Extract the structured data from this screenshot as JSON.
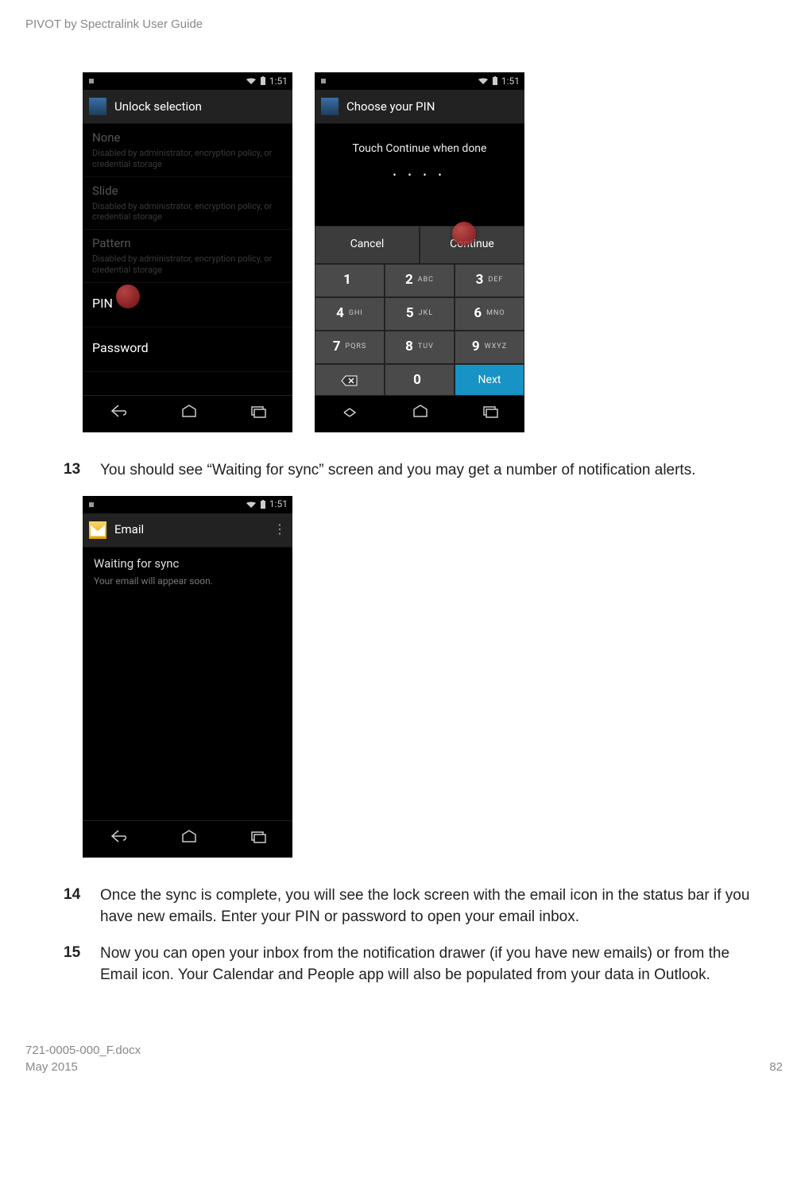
{
  "doc": {
    "running_header": "PIVOT by Spectralink User Guide",
    "footer_left_line1": "721-0005-000_F.docx",
    "footer_left_line2": "May 2015",
    "footer_right": "82"
  },
  "steps": {
    "s13_num": "13",
    "s13_text": "You should see “Waiting for sync” screen and you may get a number of notification alerts.",
    "s14_num": "14",
    "s14_text": "Once the sync is complete, you will see the lock screen with the email icon in the status bar if you have new emails. Enter your PIN or password to open your email inbox.",
    "s15_num": "15",
    "s15_text": "Now you can open your inbox from the notification drawer (if you have new emails) or from the Email icon. Your Calendar and People app will also be populated from your data in Outlook."
  },
  "screen_unlock": {
    "time": "1:51",
    "title": "Unlock selection",
    "opt_none_title": "None",
    "opt_disabled_sub": "Disabled by administrator, encryption policy, or credential storage",
    "opt_slide_title": "Slide",
    "opt_pattern_title": "Pattern",
    "opt_pin_title": "PIN",
    "opt_password_title": "Password"
  },
  "screen_pin": {
    "time": "1:51",
    "title": "Choose your PIN",
    "instruction": "Touch Continue when done",
    "dots": "• • • •",
    "cancel": "Cancel",
    "continue": "Continue",
    "next": "Next",
    "keys": {
      "k1": "1",
      "k2n": "2",
      "k2l": "ABC",
      "k3n": "3",
      "k3l": "DEF",
      "k4n": "4",
      "k4l": "GHI",
      "k5n": "5",
      "k5l": "JKL",
      "k6n": "6",
      "k6l": "MNO",
      "k7n": "7",
      "k7l": "PQRS",
      "k8n": "8",
      "k8l": "TUV",
      "k9n": "9",
      "k9l": "WXYZ",
      "k0": "0"
    }
  },
  "screen_email": {
    "time": "1:51",
    "title": "Email",
    "sync_title": "Waiting for sync",
    "sync_sub": "Your email will appear soon."
  }
}
